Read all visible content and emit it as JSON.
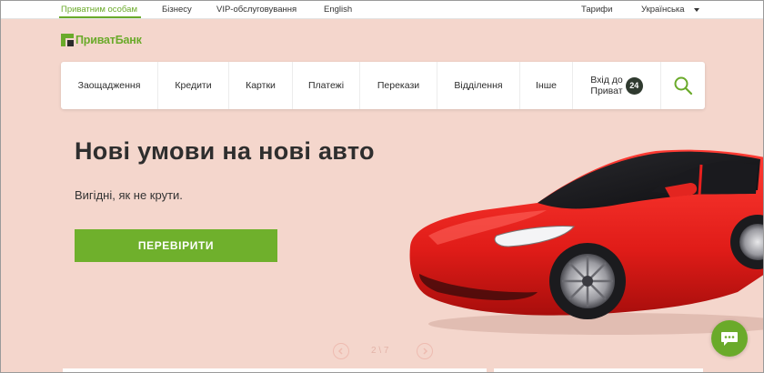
{
  "topbar": {
    "private": "Приватним особам",
    "business": "Бізнесу",
    "vip": "VIP-обслуговування",
    "english": "English",
    "tariffs": "Тарифи",
    "language": "Українська"
  },
  "logo": {
    "text": "ПриватБанк"
  },
  "nav": {
    "items": [
      {
        "label": "Заощадження"
      },
      {
        "label": "Кредити"
      },
      {
        "label": "Картки"
      },
      {
        "label": "Платежі"
      },
      {
        "label": "Перекази"
      },
      {
        "label": "Відділення"
      },
      {
        "label": "Інше"
      }
    ],
    "login_line1": "Вхід до",
    "login_line2": "Приват",
    "login_badge": "24"
  },
  "hero": {
    "title": "Нові умови на нові авто",
    "subtitle": "Вигідні, як не крути.",
    "cta": "ПЕРЕВІРИТИ"
  },
  "carousel": {
    "pager": "2 \\ 7"
  },
  "colors": {
    "brand_green": "#6aaa2a",
    "hero_bg": "#f4d6cc",
    "car_red": "#e8201e"
  }
}
